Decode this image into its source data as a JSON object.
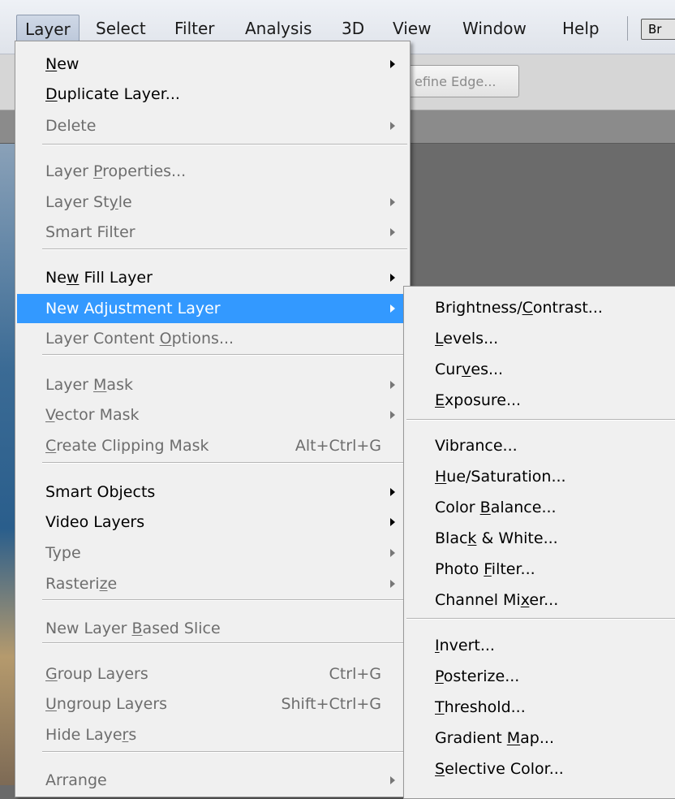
{
  "menubar": {
    "items": [
      "Layer",
      "Select",
      "Filter",
      "Analysis",
      "3D",
      "View",
      "Window",
      "Help"
    ],
    "bridge_label": "Br"
  },
  "options": {
    "refine_edge": "efine Edge..."
  },
  "layer_menu": {
    "items": [
      {
        "label": "New",
        "mn": 0,
        "arrow": true,
        "enabled": true
      },
      {
        "label": "Duplicate Layer...",
        "mn": 0,
        "enabled": true
      },
      {
        "label": "Delete",
        "arrow": true,
        "enabled": false
      },
      {
        "label": "Layer Properties...",
        "mn": 6,
        "enabled": false
      },
      {
        "label": "Layer Style",
        "mn": 8,
        "arrow": true,
        "enabled": false
      },
      {
        "label": "Smart Filter",
        "arrow": true,
        "enabled": false
      },
      {
        "label": "New Fill Layer",
        "mn": 2,
        "arrow": true,
        "enabled": true
      },
      {
        "label": "New Adjustment Layer",
        "arrow": true,
        "enabled": true,
        "highlighted": true
      },
      {
        "label": "Layer Content Options...",
        "mn": 14,
        "enabled": false
      },
      {
        "label": "Layer Mask",
        "mn": 6,
        "arrow": true,
        "enabled": false
      },
      {
        "label": "Vector Mask",
        "mn": 0,
        "arrow": true,
        "enabled": false
      },
      {
        "label": "Create Clipping Mask",
        "mn": 0,
        "shortcut": "Alt+Ctrl+G",
        "enabled": false
      },
      {
        "label": "Smart Objects",
        "arrow": true,
        "enabled": true
      },
      {
        "label": "Video Layers",
        "arrow": true,
        "enabled": true
      },
      {
        "label": "Type",
        "arrow": true,
        "enabled": false
      },
      {
        "label": "Rasterize",
        "mn": 7,
        "arrow": true,
        "enabled": false
      },
      {
        "label": "New Layer Based Slice",
        "mn": 10,
        "enabled": false
      },
      {
        "label": "Group Layers",
        "mn": 0,
        "shortcut": "Ctrl+G",
        "enabled": false
      },
      {
        "label": "Ungroup Layers",
        "mn": 0,
        "shortcut": "Shift+Ctrl+G",
        "enabled": false
      },
      {
        "label": "Hide Layers",
        "mn": 9,
        "enabled": false
      },
      {
        "label": "Arrange",
        "arrow": true,
        "enabled": false
      }
    ]
  },
  "adjustment_menu": {
    "items": [
      {
        "label": "Brightness/Contrast...",
        "mn": 11
      },
      {
        "label": "Levels...",
        "mn": 0
      },
      {
        "label": "Curves...",
        "mn": 3
      },
      {
        "label": "Exposure...",
        "mn": 0
      },
      {
        "label": "Vibrance..."
      },
      {
        "label": "Hue/Saturation...",
        "mn": 0
      },
      {
        "label": "Color Balance...",
        "mn": 6
      },
      {
        "label": "Black & White...",
        "mn": 4
      },
      {
        "label": "Photo Filter...",
        "mn": 6
      },
      {
        "label": "Channel Mixer...",
        "mn": 10
      },
      {
        "label": "Invert...",
        "mn": 0
      },
      {
        "label": "Posterize...",
        "mn": 0
      },
      {
        "label": "Threshold...",
        "mn": 0
      },
      {
        "label": "Gradient Map...",
        "mn": 9
      },
      {
        "label": "Selective Color...",
        "mn": 0
      }
    ]
  }
}
